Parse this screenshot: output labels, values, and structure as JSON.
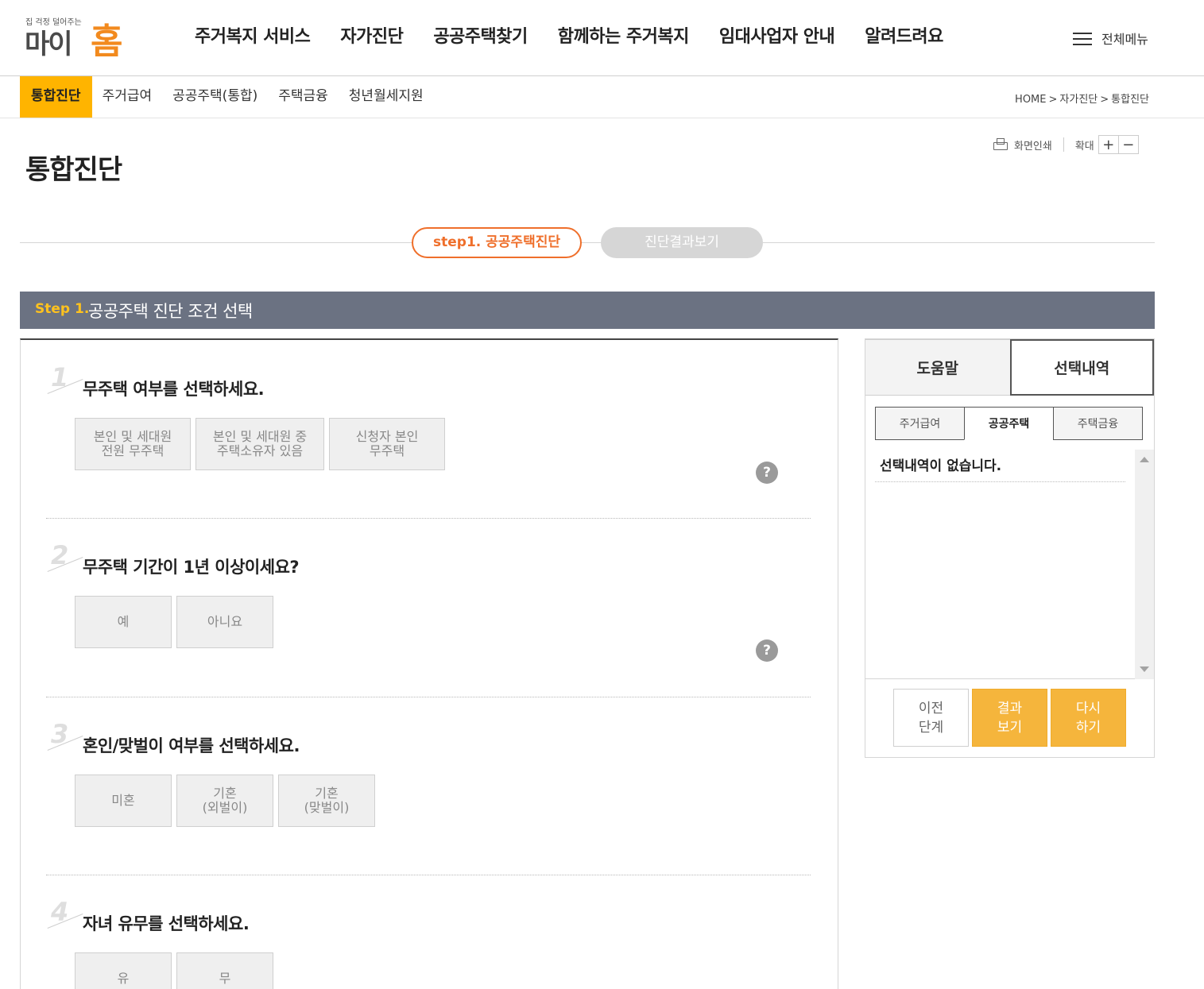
{
  "logo": {
    "tagline": "집 걱정 덜어주는",
    "name_part1": "마이",
    "name_part2": "홈"
  },
  "gnb": [
    {
      "label": "주거복지 서비스"
    },
    {
      "label": "자가진단",
      "active": true
    },
    {
      "label": "공공주택찾기"
    },
    {
      "label": "함께하는 주거복지"
    },
    {
      "label": "임대사업자 안내"
    },
    {
      "label": "알려드려요"
    }
  ],
  "all_menu_label": "전체메뉴",
  "subnav": [
    {
      "label": "통합진단",
      "active": true
    },
    {
      "label": "주거급여"
    },
    {
      "label": "공공주택(통합)"
    },
    {
      "label": "주택금융"
    },
    {
      "label": "청년월세지원"
    }
  ],
  "breadcrumb": [
    "HOME",
    "자가진단",
    "통합진단"
  ],
  "page_title": "통합진단",
  "tools": {
    "print": "화면인쇄",
    "zoom": "확대",
    "plus": "+",
    "minus": "−"
  },
  "steps": {
    "step1": "step1. 공공주택진단",
    "step2": "진단결과보기"
  },
  "step_bar": {
    "label": "Step 1.",
    "title": "공공주택 진단 조건 선택"
  },
  "questions": [
    {
      "num": "1",
      "text": "무주택 여부를 선택하세요.",
      "options": [
        "본인 및 세대원\n전원 무주택",
        "본인 및 세대원 중\n주택소유자 있음",
        "신청자 본인\n무주택"
      ]
    },
    {
      "num": "2",
      "text": "무주택 기간이 1년 이상이세요?",
      "options": [
        "예",
        "아니요"
      ]
    },
    {
      "num": "3",
      "text": "혼인/맞벌이 여부를 선택하세요.",
      "options": [
        "미혼",
        "기혼\n(외벌이)",
        "기혼\n(맞벌이)"
      ]
    },
    {
      "num": "4",
      "text": "자녀 유무를 선택하세요.",
      "options": [
        "유",
        "무"
      ]
    }
  ],
  "help_label": "?",
  "right_panel": {
    "tabs": [
      "도움말",
      "선택내역"
    ],
    "sub_tabs": [
      "주거급여",
      "공공주택",
      "주택금융"
    ],
    "empty_text": "선택내역이 없습니다.",
    "buttons": {
      "prev": "이전\n단계",
      "result": "결과\n보기",
      "retry": "다시\n하기"
    }
  },
  "colors": {
    "accent": "#ffb400",
    "step_active": "#ef6f2b",
    "step_bar": "#6b7282",
    "button_orange": "#f5b53c"
  }
}
